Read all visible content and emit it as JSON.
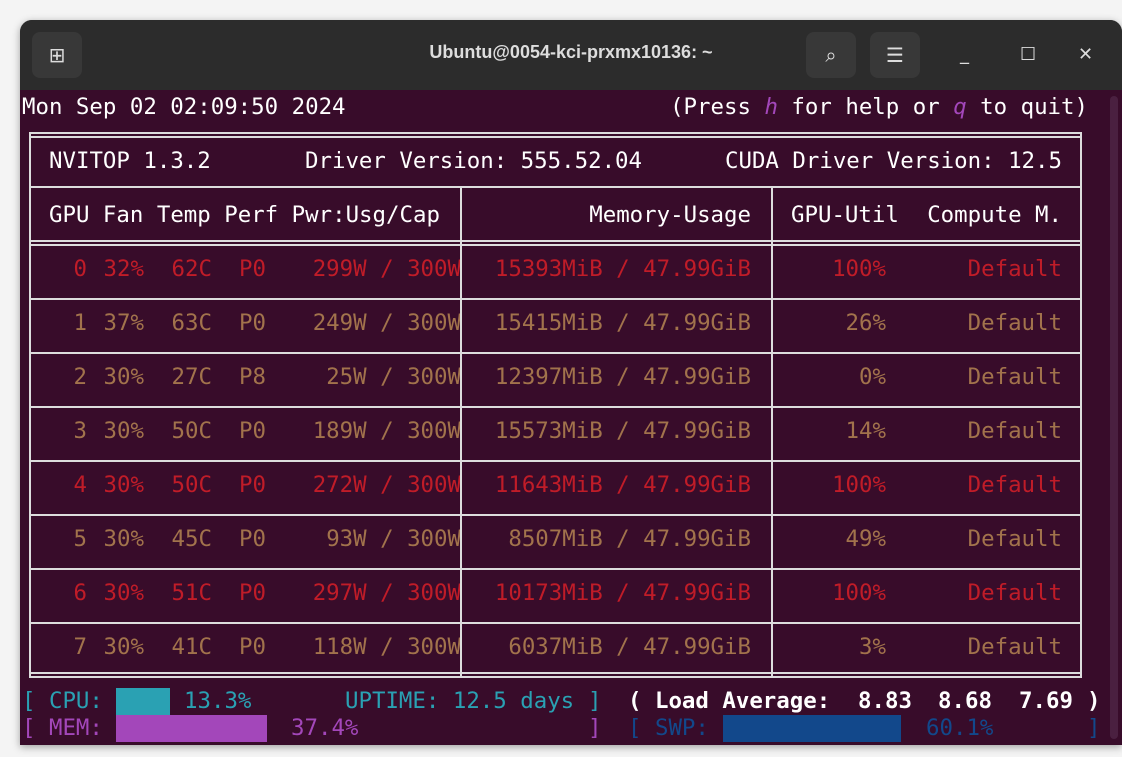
{
  "window": {
    "title": "Ubuntu@0054-kci-prxmx10136: ~"
  },
  "header": {
    "datetime": "Mon Sep 02 02:09:50 2024",
    "help_prefix": "(Press ",
    "help_key_h": "h",
    "help_mid": " for help or ",
    "help_key_q": "q",
    "help_suffix": " to quit)"
  },
  "info": {
    "nvitop": "NVITOP 1.3.2",
    "driver": "Driver Version: 555.52.04",
    "cuda": "CUDA Driver Version: 12.5"
  },
  "columns": {
    "left": "GPU Fan Temp Perf Pwr:Usg/Cap",
    "memory": "Memory-Usage",
    "util": "GPU-Util",
    "compute": "Compute M."
  },
  "colors": {
    "high": "#c01c28",
    "normal": "#a2734c",
    "background": "#380c2a"
  },
  "gpus": [
    {
      "id": "0",
      "fan": "32%",
      "temp": "62C",
      "perf": "P0",
      "power": "299W / 300W",
      "memory": "15393MiB / 47.99GiB",
      "util": "100%",
      "compute": "Default",
      "status": "high"
    },
    {
      "id": "1",
      "fan": "37%",
      "temp": "63C",
      "perf": "P0",
      "power": "249W / 300W",
      "memory": "15415MiB / 47.99GiB",
      "util": "26%",
      "compute": "Default",
      "status": "normal"
    },
    {
      "id": "2",
      "fan": "30%",
      "temp": "27C",
      "perf": "P8",
      "power": "25W / 300W",
      "memory": "12397MiB / 47.99GiB",
      "util": "0%",
      "compute": "Default",
      "status": "normal"
    },
    {
      "id": "3",
      "fan": "30%",
      "temp": "50C",
      "perf": "P0",
      "power": "189W / 300W",
      "memory": "15573MiB / 47.99GiB",
      "util": "14%",
      "compute": "Default",
      "status": "normal"
    },
    {
      "id": "4",
      "fan": "30%",
      "temp": "50C",
      "perf": "P0",
      "power": "272W / 300W",
      "memory": "11643MiB / 47.99GiB",
      "util": "100%",
      "compute": "Default",
      "status": "high"
    },
    {
      "id": "5",
      "fan": "30%",
      "temp": "45C",
      "perf": "P0",
      "power": "93W / 300W",
      "memory": "8507MiB / 47.99GiB",
      "util": "49%",
      "compute": "Default",
      "status": "normal"
    },
    {
      "id": "6",
      "fan": "30%",
      "temp": "51C",
      "perf": "P0",
      "power": "297W / 300W",
      "memory": "10173MiB / 47.99GiB",
      "util": "100%",
      "compute": "Default",
      "status": "high"
    },
    {
      "id": "7",
      "fan": "30%",
      "temp": "41C",
      "perf": "P0",
      "power": "118W / 300W",
      "memory": "6037MiB / 47.99GiB",
      "util": "3%",
      "compute": "Default",
      "status": "normal"
    }
  ],
  "system": {
    "cpu_label": "CPU:",
    "cpu_value": "13.3%",
    "cpu_fraction": 0.133,
    "uptime": "UPTIME: 12.5 days",
    "load_label": "( Load Average:",
    "load": [
      "8.83",
      "8.68",
      "7.69"
    ],
    "load_close": ")",
    "mem_label": "MEM:",
    "mem_value": "37.4%",
    "mem_fraction": 0.374,
    "swp_label": "SWP:",
    "swp_value": "60.1%",
    "swp_fraction": 0.601,
    "open_bracket": "[",
    "close_bracket": "]"
  }
}
